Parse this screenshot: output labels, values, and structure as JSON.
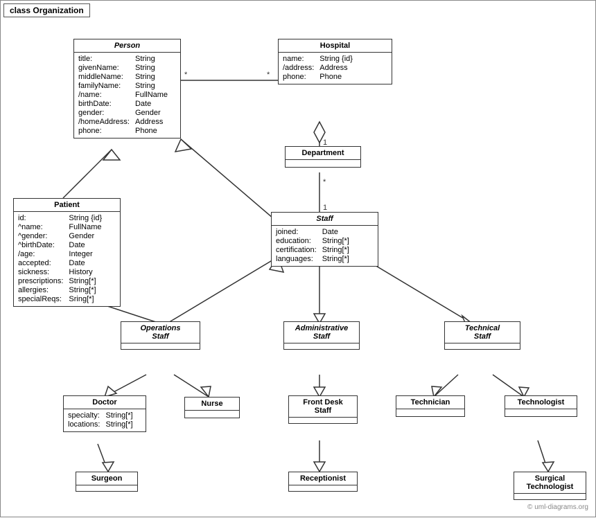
{
  "diagram": {
    "title": "class Organization",
    "classes": {
      "person": {
        "name": "Person",
        "italic": true,
        "attrs": [
          [
            "title:",
            "String"
          ],
          [
            "givenName:",
            "String"
          ],
          [
            "middleName:",
            "String"
          ],
          [
            "familyName:",
            "String"
          ],
          [
            "/name:",
            "FullName"
          ],
          [
            "birthDate:",
            "Date"
          ],
          [
            "gender:",
            "Gender"
          ],
          [
            "/homeAddress:",
            "Address"
          ],
          [
            "phone:",
            "Phone"
          ]
        ]
      },
      "hospital": {
        "name": "Hospital",
        "italic": false,
        "attrs": [
          [
            "name:",
            "String {id}"
          ],
          [
            "/address:",
            "Address"
          ],
          [
            "phone:",
            "Phone"
          ]
        ]
      },
      "department": {
        "name": "Department",
        "italic": false,
        "attrs": []
      },
      "staff": {
        "name": "Staff",
        "italic": true,
        "attrs": [
          [
            "joined:",
            "Date"
          ],
          [
            "education:",
            "String[*]"
          ],
          [
            "certification:",
            "String[*]"
          ],
          [
            "languages:",
            "String[*]"
          ]
        ]
      },
      "patient": {
        "name": "Patient",
        "italic": false,
        "attrs": [
          [
            "id:",
            "String {id}"
          ],
          [
            "^name:",
            "FullName"
          ],
          [
            "^gender:",
            "Gender"
          ],
          [
            "^birthDate:",
            "Date"
          ],
          [
            "/age:",
            "Integer"
          ],
          [
            "accepted:",
            "Date"
          ],
          [
            "sickness:",
            "History"
          ],
          [
            "prescriptions:",
            "String[*]"
          ],
          [
            "allergies:",
            "String[*]"
          ],
          [
            "specialReqs:",
            "Sring[*]"
          ]
        ]
      },
      "operations_staff": {
        "name": "Operations\nStaff",
        "italic": true,
        "attrs": []
      },
      "administrative_staff": {
        "name": "Administrative\nStaff",
        "italic": true,
        "attrs": []
      },
      "technical_staff": {
        "name": "Technical\nStaff",
        "italic": true,
        "attrs": []
      },
      "doctor": {
        "name": "Doctor",
        "italic": false,
        "attrs": [
          [
            "specialty:",
            "String[*]"
          ],
          [
            "locations:",
            "String[*]"
          ]
        ]
      },
      "nurse": {
        "name": "Nurse",
        "italic": false,
        "attrs": []
      },
      "front_desk_staff": {
        "name": "Front Desk\nStaff",
        "italic": false,
        "attrs": []
      },
      "technician": {
        "name": "Technician",
        "italic": false,
        "attrs": []
      },
      "technologist": {
        "name": "Technologist",
        "italic": false,
        "attrs": []
      },
      "surgeon": {
        "name": "Surgeon",
        "italic": false,
        "attrs": []
      },
      "receptionist": {
        "name": "Receptionist",
        "italic": false,
        "attrs": []
      },
      "surgical_technologist": {
        "name": "Surgical\nTechnologist",
        "italic": false,
        "attrs": []
      }
    },
    "watermark": "© uml-diagrams.org"
  }
}
